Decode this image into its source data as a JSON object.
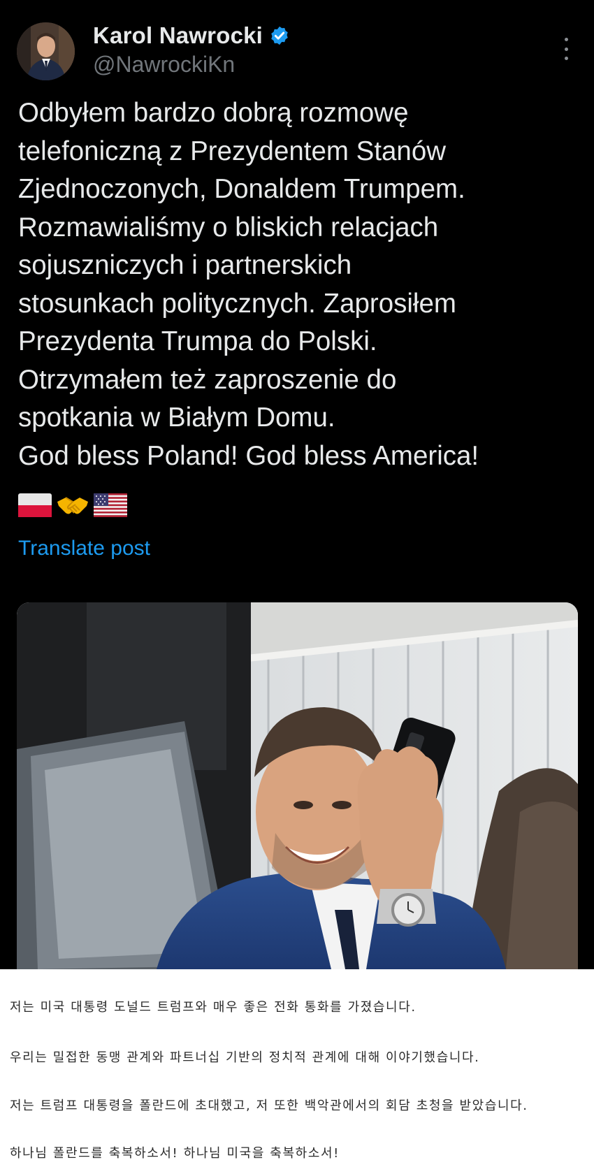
{
  "author": {
    "display_name": "Karol Nawrocki",
    "handle": "@NawrockiKn",
    "verified": true
  },
  "post": {
    "lines": [
      "Odbyłem bardzo dobrą rozmowę",
      "telefoniczną z Prezydentem Stanów",
      "Zjednoczonych, Donaldem Trumpem.",
      "Rozmawialiśmy o bliskich relacjach",
      "sojuszniczych i partnerskich",
      "stosunkach politycznych. Zaprosiłem",
      "Prezydenta Trumpa do Polski.",
      "Otrzymałem też zaproszenie do",
      "spotkania w Białym Domu.",
      "God bless Poland! God bless America!"
    ],
    "emojis": [
      "poland-flag-icon",
      "handshake-icon",
      "us-flag-icon"
    ],
    "translate_label": "Translate post"
  },
  "translation": {
    "lines": [
      "저는 미국 대통령 도널드 트럼프와 매우 좋은 전화 통화를 가졌습니다.",
      "우리는 밀접한 동맹 관계와 파트너십 기반의 정치적 관계에 대해 이야기했습니다.",
      "저는 트럼프 대통령을 폴란드에 초대했고, 저 또한 백악관에서의 회담 초청을 받았습니다.",
      "하나님 폴란드를 축복하소서! 하나님 미국을 축복하소서!"
    ]
  },
  "colors": {
    "background": "#000000",
    "text": "#e7e9ea",
    "secondary_text": "#71767b",
    "link": "#1d9bf0",
    "verified_badge": "#1d9bf0"
  }
}
